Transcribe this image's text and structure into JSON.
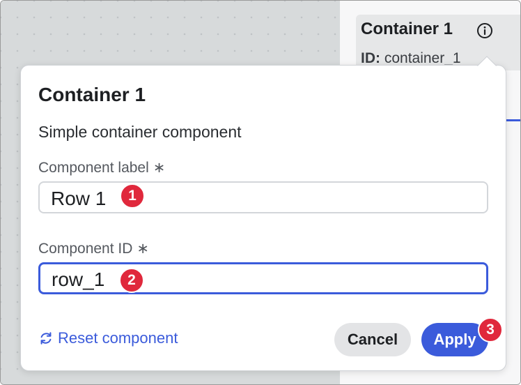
{
  "header": {
    "title": "Container 1",
    "id_label": "ID:",
    "id_value": "container_1"
  },
  "popover": {
    "title": "Container 1",
    "description": "Simple container component",
    "label_field": {
      "label": "Component label",
      "required_mark": "∗",
      "value": "Row 1"
    },
    "id_field": {
      "label": "Component ID",
      "required_mark": "∗",
      "value": "row_1"
    },
    "reset_label": "Reset component",
    "cancel_label": "Cancel",
    "apply_label": "Apply"
  },
  "badges": [
    "1",
    "2",
    "3"
  ],
  "icons": {
    "info": "info-icon",
    "reset": "refresh-icon"
  },
  "colors": {
    "accent": "#3b5bdb",
    "badge": "#e0283c",
    "cancel_bg": "#e3e4e6",
    "canvas_bg": "#d7dadb"
  }
}
